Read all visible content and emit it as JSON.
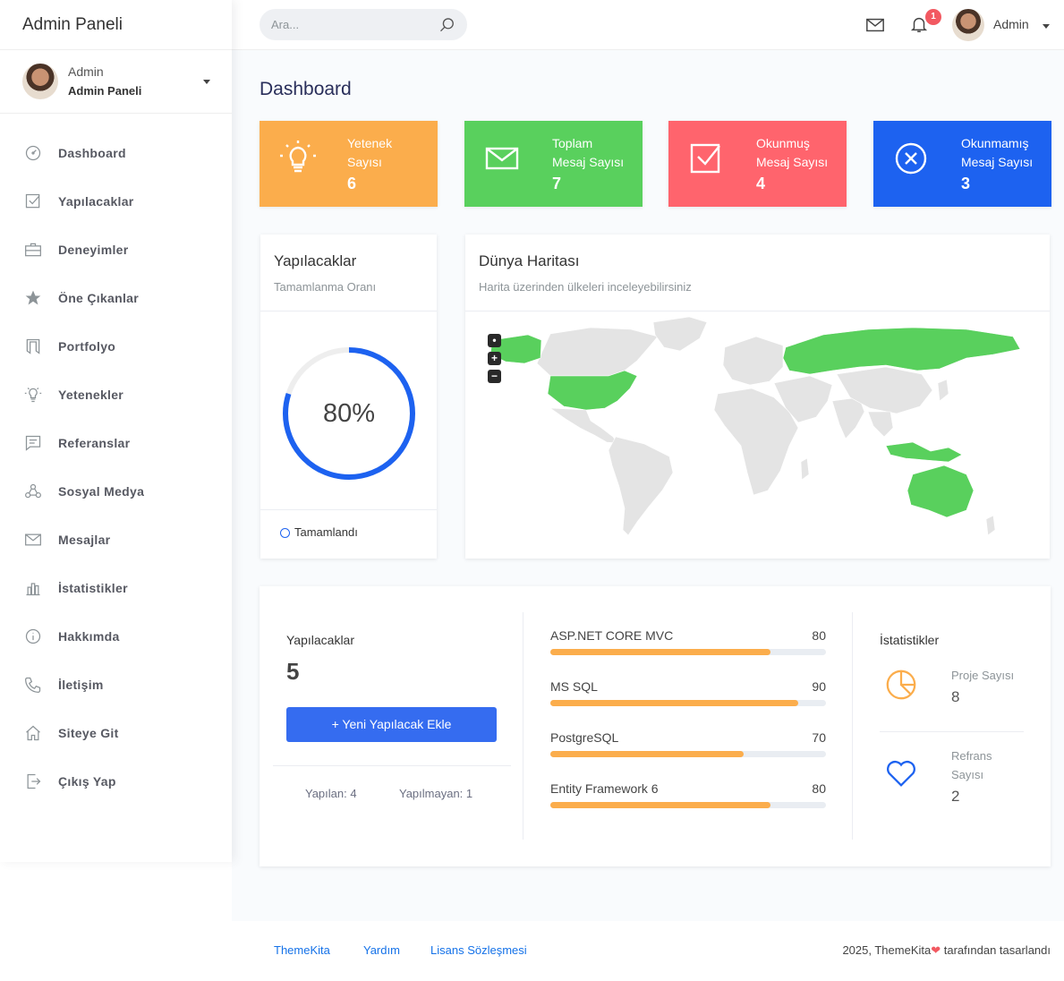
{
  "brand": "Admin Paneli",
  "user": {
    "name": "Admin",
    "role": "Admin Paneli"
  },
  "sidebar": {
    "items": [
      {
        "label": "Dashboard",
        "icon": "dashboard-icon"
      },
      {
        "label": "Yapılacaklar",
        "icon": "checkbox-icon"
      },
      {
        "label": "Deneyimler",
        "icon": "briefcase-icon"
      },
      {
        "label": "Öne Çıkanlar",
        "icon": "star-icon"
      },
      {
        "label": "Portfolyo",
        "icon": "portfolio-icon"
      },
      {
        "label": "Yetenekler",
        "icon": "bulb-icon"
      },
      {
        "label": "Referanslar",
        "icon": "message-icon"
      },
      {
        "label": "Sosyal Medya",
        "icon": "social-icon"
      },
      {
        "label": "Mesajlar",
        "icon": "envelope-icon"
      },
      {
        "label": "İstatistikler",
        "icon": "chart-icon"
      },
      {
        "label": "Hakkımda",
        "icon": "info-icon"
      },
      {
        "label": "İletişim",
        "icon": "phone-icon"
      },
      {
        "label": "Siteye Git",
        "icon": "home-icon"
      },
      {
        "label": "Çıkış Yap",
        "icon": "logout-icon"
      }
    ]
  },
  "topbar": {
    "search_placeholder": "Ara...",
    "notification_count": "1",
    "user_name": "Admin"
  },
  "page_title": "Dashboard",
  "stats": [
    {
      "label1": "Yetenek",
      "label2": "Sayısı",
      "value": "6",
      "color": "#fbad4c",
      "icon": "bulb-icon"
    },
    {
      "label1": "Toplam",
      "label2": "Mesaj Sayısı",
      "value": "7",
      "color": "#59d05d",
      "icon": "envelope-icon"
    },
    {
      "label1": "Okunmuş",
      "label2": "Mesaj Sayısı",
      "value": "4",
      "color": "#ff646d",
      "icon": "checkbox-icon"
    },
    {
      "label1": "Okunmamış",
      "label2": "Mesaj Sayısı",
      "value": "3",
      "color": "#1d62f0",
      "icon": "close-circle-icon"
    }
  ],
  "progress_card": {
    "title": "Yapılacaklar",
    "subtitle": "Tamamlanma Oranı",
    "percent": 80,
    "percent_label": "80%",
    "legend": "Tamamlandı"
  },
  "map_card": {
    "title": "Dünya Haritası",
    "subtitle": "Harita üzerinden ülkeleri inceleyebilirsiniz",
    "highlight_color": "#59d05d",
    "base_color": "#e4e4e4",
    "highlighted": [
      "United States",
      "Russia",
      "Australia",
      "Indonesia",
      "Alaska"
    ]
  },
  "todo_summary": {
    "title": "Yapılacaklar",
    "count": "5",
    "add_button": "Yeni Yapılacak Ekle",
    "done": "Yapılan: 4",
    "not_done": "Yapılmayan: 1"
  },
  "skills": [
    {
      "name": "ASP.NET CORE MVC",
      "value": 80
    },
    {
      "name": "MS SQL",
      "value": 90
    },
    {
      "name": "PostgreSQL",
      "value": 70
    },
    {
      "name": "Entity Framework 6",
      "value": 80
    }
  ],
  "statistics": {
    "title": "İstatistikler",
    "projects_label": "Proje Sayısı",
    "projects_value": "8",
    "references_label1": "Refrans",
    "references_label2": "Sayısı",
    "references_value": "2"
  },
  "footer": {
    "links": [
      "ThemeKita",
      "Yardım",
      "Lisans Sözleşmesi"
    ],
    "copy_pre": "2025, ThemeKita",
    "copy_post": " tarafından tasarlandı"
  }
}
